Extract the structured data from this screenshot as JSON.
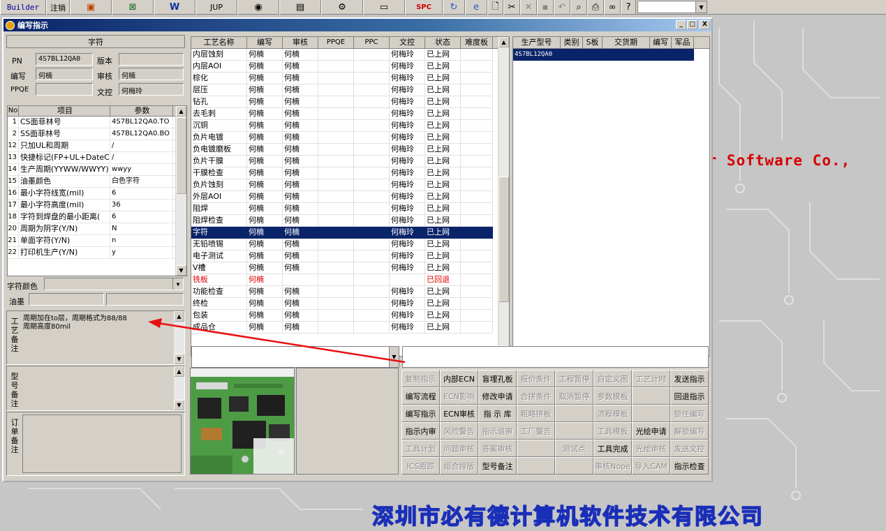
{
  "toolbar": {
    "builder_label": "Builder",
    "logout_label": "注销",
    "jup_label": "JUP",
    "spc_label": "SPC",
    "icons": [
      "ppt-icon",
      "excel-icon",
      "word-icon",
      "jup",
      "eye-icon",
      "database-icon",
      "connect-icon",
      "computer-icon",
      "spc",
      "refresh-icon",
      "ie-icon",
      "new-doc-icon",
      "cut-icon",
      "cross-icon",
      "save-icon",
      "undo-icon",
      "preview-icon",
      "print-icon",
      "binoculars-icon",
      "help-icon"
    ]
  },
  "window": {
    "title": "编写指示",
    "min_label": "_",
    "max_label": "□",
    "close_label": "X"
  },
  "left": {
    "section_title": "字符",
    "pn_label": "PN",
    "pn_value": "4S7BL12QA0",
    "version_label": "版本",
    "version_value": "",
    "writer_label": "编写",
    "writer_value": "何楠",
    "review_label": "审核",
    "review_value": "何楠",
    "ppqe_label": "PPQE",
    "ppqe_value": "",
    "doc_label": "文控",
    "doc_value": "何梅玲",
    "param_headers": [
      "No",
      "项目",
      "参数"
    ],
    "params": [
      {
        "no": "1",
        "item": "CS面菲林号",
        "val": "4S7BL12QA0.TO"
      },
      {
        "no": "2",
        "item": "SS面菲林号",
        "val": "4S7BL12QA0.BO"
      },
      {
        "no": "12",
        "item": "只加UL和周期",
        "val": "/"
      },
      {
        "no": "13",
        "item": "快捷标记(FP+UL+DateCo",
        "val": "/"
      },
      {
        "no": "14",
        "item": "生产周期(YYWW/WWYY)",
        "val": "wwyy"
      },
      {
        "no": "15",
        "item": "油墨颜色",
        "val": "白色字符"
      },
      {
        "no": "16",
        "item": "最小字符线宽(mil)",
        "val": "6"
      },
      {
        "no": "17",
        "item": "最小字符高度(mil)",
        "val": "36"
      },
      {
        "no": "18",
        "item": "字符到焊盘的最小距离(",
        "val": "6"
      },
      {
        "no": "20",
        "item": "周期为阴字(Y/N)",
        "val": "N"
      },
      {
        "no": "21",
        "item": "单面字符(Y/N)",
        "val": "n"
      },
      {
        "no": "22",
        "item": "打印机生产(Y/N)",
        "val": "y"
      }
    ],
    "char_color_label": "字符颜色",
    "ink_label": "油墨",
    "process_remark_label": "工艺备注",
    "process_remark_text": "周期加在to层，周期格式为88/88\n周期高度80mil",
    "model_remark_label": "型号备注",
    "order_remark_label": "订单备注"
  },
  "process_grid": {
    "headers": [
      "工艺名称",
      "编写",
      "审核",
      "PPQE",
      "PPC",
      "文控",
      "状态",
      "难度板"
    ],
    "rows": [
      {
        "name": "内层蚀刻",
        "w": "何楠",
        "r": "何楠",
        "d": "何梅玲",
        "s": "已上网"
      },
      {
        "name": "内层AOI",
        "w": "何楠",
        "r": "何楠",
        "d": "何梅玲",
        "s": "已上网"
      },
      {
        "name": "棕化",
        "w": "何楠",
        "r": "何楠",
        "d": "何梅玲",
        "s": "已上网"
      },
      {
        "name": "层压",
        "w": "何楠",
        "r": "何楠",
        "d": "何梅玲",
        "s": "已上网"
      },
      {
        "name": "钻孔",
        "w": "何楠",
        "r": "何楠",
        "d": "何梅玲",
        "s": "已上网"
      },
      {
        "name": "去毛刺",
        "w": "何楠",
        "r": "何楠",
        "d": "何梅玲",
        "s": "已上网"
      },
      {
        "name": "沉铜",
        "w": "何楠",
        "r": "何楠",
        "d": "何梅玲",
        "s": "已上网"
      },
      {
        "name": "负片电镀",
        "w": "何楠",
        "r": "何楠",
        "d": "何梅玲",
        "s": "已上网"
      },
      {
        "name": "负电镀磨板",
        "w": "何楠",
        "r": "何楠",
        "d": "何梅玲",
        "s": "已上网"
      },
      {
        "name": "负片干膜",
        "w": "何楠",
        "r": "何楠",
        "d": "何梅玲",
        "s": "已上网"
      },
      {
        "name": "干膜检查",
        "w": "何楠",
        "r": "何楠",
        "d": "何梅玲",
        "s": "已上网"
      },
      {
        "name": "负片蚀刻",
        "w": "何楠",
        "r": "何楠",
        "d": "何梅玲",
        "s": "已上网"
      },
      {
        "name": "外层AOI",
        "w": "何楠",
        "r": "何楠",
        "d": "何梅玲",
        "s": "已上网"
      },
      {
        "name": "阻焊",
        "w": "何楠",
        "r": "何楠",
        "d": "何梅玲",
        "s": "已上网"
      },
      {
        "name": "阻焊检查",
        "w": "何楠",
        "r": "何楠",
        "d": "何梅玲",
        "s": "已上网"
      },
      {
        "name": "字符",
        "w": "何楠",
        "r": "何楠",
        "d": "何梅玲",
        "s": "已上网"
      },
      {
        "name": "无铅喷锡",
        "w": "何楠",
        "r": "何楠",
        "d": "何梅玲",
        "s": "已上网"
      },
      {
        "name": "电子测试",
        "w": "何楠",
        "r": "何楠",
        "d": "何梅玲",
        "s": "已上网"
      },
      {
        "name": "V槽",
        "w": "何楠",
        "r": "何楠",
        "d": "何梅玲",
        "s": "已上网"
      },
      {
        "name": "铣板",
        "w": "何楠",
        "r": "",
        "d": "",
        "s": "已回退"
      },
      {
        "name": "功能检查",
        "w": "何楠",
        "r": "何楠",
        "d": "何梅玲",
        "s": "已上网"
      },
      {
        "name": "终检",
        "w": "何楠",
        "r": "何楠",
        "d": "何梅玲",
        "s": "已上网"
      },
      {
        "name": "包装",
        "w": "何楠",
        "r": "何楠",
        "d": "何梅玲",
        "s": "已上网"
      },
      {
        "name": "成品仓",
        "w": "何楠",
        "r": "何楠",
        "d": "何梅玲",
        "s": "已上网"
      }
    ],
    "selected_index": 15,
    "returned_index": 19
  },
  "model_grid": {
    "headers": [
      "生产型号",
      "类别",
      "S板",
      "交货期",
      "编写",
      "军品"
    ],
    "rows": [
      {
        "model": "4S7BL12QA0"
      }
    ]
  },
  "buttons": [
    {
      "label": "复制指示",
      "enabled": false
    },
    {
      "label": "内部ECN",
      "enabled": true
    },
    {
      "label": "盲埋孔板",
      "enabled": true
    },
    {
      "label": "报价条件",
      "enabled": false
    },
    {
      "label": "工程暂停",
      "enabled": false
    },
    {
      "label": "自定义图",
      "enabled": false
    },
    {
      "label": "工艺计时",
      "enabled": false
    },
    {
      "label": "发送指示",
      "enabled": true
    },
    {
      "label": "编写流程",
      "enabled": true
    },
    {
      "label": "ECN影响",
      "enabled": false
    },
    {
      "label": "修改申请",
      "enabled": true
    },
    {
      "label": "合拼条件",
      "enabled": false
    },
    {
      "label": "取消暂停",
      "enabled": false
    },
    {
      "label": "参数模板",
      "enabled": false
    },
    {
      "label": "",
      "enabled": false
    },
    {
      "label": "回退指示",
      "enabled": true
    },
    {
      "label": "编写指示",
      "enabled": true
    },
    {
      "label": "ECN审核",
      "enabled": true
    },
    {
      "label": "指 示 库",
      "enabled": true
    },
    {
      "label": "粗略拼板",
      "enabled": false
    },
    {
      "label": "",
      "enabled": false
    },
    {
      "label": "流程模板",
      "enabled": false
    },
    {
      "label": "",
      "enabled": false
    },
    {
      "label": "锁住编写",
      "enabled": false
    },
    {
      "label": "指示内审",
      "enabled": true
    },
    {
      "label": "风险警告",
      "enabled": false
    },
    {
      "label": "指示退审",
      "enabled": false
    },
    {
      "label": "工厂警告",
      "enabled": false
    },
    {
      "label": "",
      "enabled": false
    },
    {
      "label": "工具模板",
      "enabled": false
    },
    {
      "label": "光绘申请",
      "enabled": true
    },
    {
      "label": "解锁编写",
      "enabled": false
    },
    {
      "label": "工具计划",
      "enabled": false
    },
    {
      "label": "问题审核",
      "enabled": false
    },
    {
      "label": "答案审核",
      "enabled": false
    },
    {
      "label": "",
      "enabled": false
    },
    {
      "label": "测试点",
      "enabled": false
    },
    {
      "label": "工具完成",
      "enabled": true
    },
    {
      "label": "光绘审核",
      "enabled": false
    },
    {
      "label": "发送文控",
      "enabled": false
    },
    {
      "label": "ICS跟踪",
      "enabled": false
    },
    {
      "label": "组合排版",
      "enabled": false
    },
    {
      "label": "型号备注",
      "enabled": true
    },
    {
      "label": "",
      "enabled": false
    },
    {
      "label": "",
      "enabled": false
    },
    {
      "label": "审核Nope",
      "enabled": false
    },
    {
      "label": "导入CAM",
      "enabled": false
    },
    {
      "label": "指示检查",
      "enabled": true
    }
  ],
  "background": {
    "software_text": "er Software Co.,",
    "company_text": "深圳市必有德计算机软件技术有限公司"
  },
  "colors": {
    "selection": "#0a246a",
    "returned": "#e00000",
    "arrow": "#e81010"
  }
}
